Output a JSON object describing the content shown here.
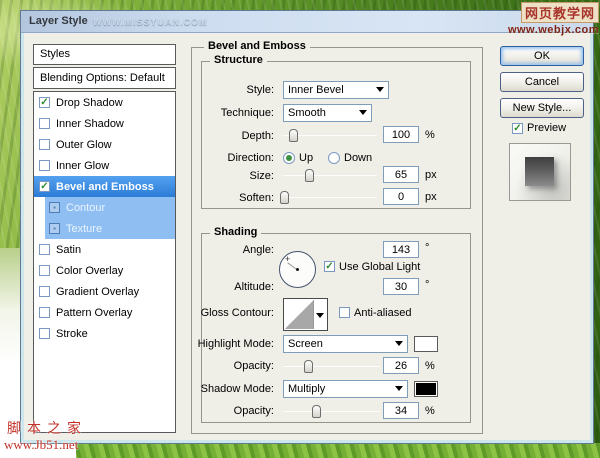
{
  "watermarks": {
    "titlebar": "WWW.MISSYUAN.COM",
    "top_right_line1": "网页教学网",
    "top_right_line2": "www.webjx.com",
    "bottom_left_line1": "脚本之家",
    "bottom_left_line2": "www.Jb51.net"
  },
  "dialog": {
    "title": "Layer Style",
    "sidebar": {
      "header": "Styles",
      "blending": "Blending Options: Default",
      "items": [
        {
          "label": "Drop Shadow",
          "checked": true,
          "selected": false,
          "indent": false
        },
        {
          "label": "Inner Shadow",
          "checked": false,
          "selected": false,
          "indent": false
        },
        {
          "label": "Outer Glow",
          "checked": false,
          "selected": false,
          "indent": false
        },
        {
          "label": "Inner Glow",
          "checked": false,
          "selected": false,
          "indent": false
        },
        {
          "label": "Bevel and Emboss",
          "checked": true,
          "selected": true,
          "indent": false
        },
        {
          "label": "Contour",
          "checked": false,
          "selected": false,
          "indent": true
        },
        {
          "label": "Texture",
          "checked": false,
          "selected": false,
          "indent": true
        },
        {
          "label": "Satin",
          "checked": false,
          "selected": false,
          "indent": false
        },
        {
          "label": "Color Overlay",
          "checked": false,
          "selected": false,
          "indent": false
        },
        {
          "label": "Gradient Overlay",
          "checked": false,
          "selected": false,
          "indent": false
        },
        {
          "label": "Pattern Overlay",
          "checked": false,
          "selected": false,
          "indent": false
        },
        {
          "label": "Stroke",
          "checked": false,
          "selected": false,
          "indent": false
        }
      ]
    },
    "panel": {
      "title": "Bevel and Emboss",
      "structure": {
        "legend": "Structure",
        "style_label": "Style:",
        "style_value": "Inner Bevel",
        "technique_label": "Technique:",
        "technique_value": "Smooth",
        "depth_label": "Depth:",
        "depth_value": "100",
        "depth_unit": "%",
        "direction_label": "Direction:",
        "direction_up": "Up",
        "direction_down": "Down",
        "direction_selected": "Up",
        "size_label": "Size:",
        "size_value": "65",
        "size_unit": "px",
        "soften_label": "Soften:",
        "soften_value": "0",
        "soften_unit": "px"
      },
      "shading": {
        "legend": "Shading",
        "angle_label": "Angle:",
        "angle_value": "143",
        "angle_unit": "°",
        "use_global_light_label": "Use Global Light",
        "use_global_light_checked": true,
        "altitude_label": "Altitude:",
        "altitude_value": "30",
        "altitude_unit": "°",
        "gloss_label": "Gloss Contour:",
        "anti_aliased_label": "Anti-aliased",
        "anti_aliased_checked": false,
        "highlight_label": "Highlight Mode:",
        "highlight_value": "Screen",
        "opacity1_label": "Opacity:",
        "opacity1_value": "26",
        "opacity1_unit": "%",
        "shadow_label": "Shadow Mode:",
        "shadow_value": "Multiply",
        "opacity2_label": "Opacity:",
        "opacity2_value": "34",
        "opacity2_unit": "%"
      }
    },
    "buttons": {
      "ok": "OK",
      "cancel": "Cancel",
      "new_style": "New Style...",
      "preview": "Preview"
    },
    "colors": {
      "highlight_swatch": "#ffffff",
      "shadow_swatch": "#000000",
      "selection_blue": "#3390f0",
      "subselect_blue": "#8fbff2"
    },
    "sliders": {
      "depth_pct": 10,
      "size_pct": 26,
      "soften_pct": 0,
      "opacity1_pct": 26,
      "opacity2_pct": 34
    }
  }
}
